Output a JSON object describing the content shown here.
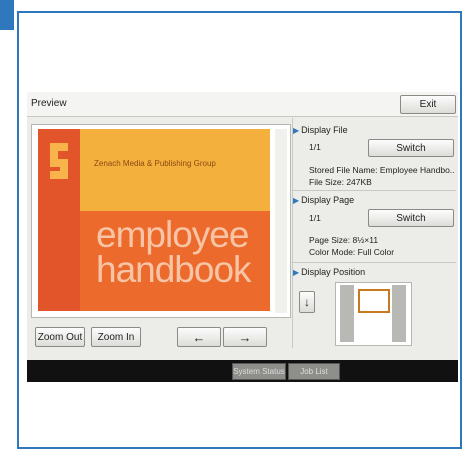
{
  "window": {
    "title": "Preview",
    "exit_label": "Exit"
  },
  "preview": {
    "publisher": "Zenach Media & Publishing Group",
    "doc_title_line1": "employee",
    "doc_title_line2": "handbook",
    "scroll_down_icon": "↓"
  },
  "controls": {
    "zoom_out": "Zoom Out",
    "zoom_in": "Zoom In",
    "prev_arrow": "←",
    "next_arrow": "→"
  },
  "display_file": {
    "heading": "Display File",
    "count": "1/1",
    "switch_label": "Switch",
    "stored_name": "Stored File Name: Employee Handbo..",
    "file_size": "File Size: 247KB"
  },
  "display_page": {
    "heading": "Display Page",
    "count": "1/1",
    "switch_label": "Switch",
    "page_size": "Page Size: 8½×11",
    "color_mode": "Color Mode: Full Color"
  },
  "display_position": {
    "heading": "Display Position"
  },
  "status_bar": {
    "system_status": "System Status",
    "job_list": "Job List"
  },
  "colors": {
    "accent": "#2f78bd",
    "cover_orange": "#ec6a2c",
    "cover_yellow": "#f4b03d"
  }
}
